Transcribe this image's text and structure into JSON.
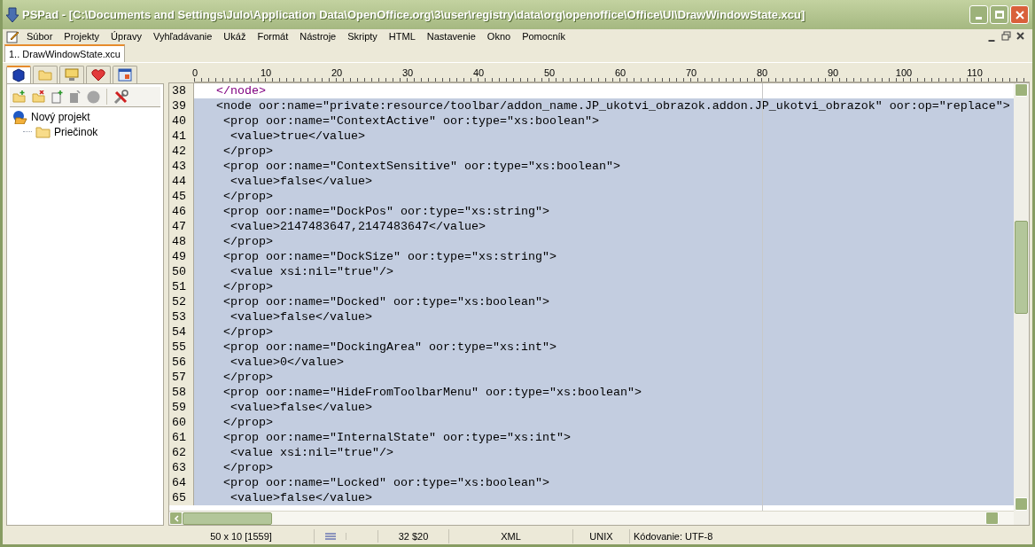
{
  "window": {
    "title": "PSPad - [C:\\Documents and Settings\\Julo\\Application Data\\OpenOffice.org\\3\\user\\registry\\data\\org\\openoffice\\Office\\UI\\DrawWindowState.xcu]"
  },
  "menu": [
    "Súbor",
    "Projekty",
    "Úpravy",
    "Vyhľadávanie",
    "Ukáž",
    "Formát",
    "Nástroje",
    "Skripty",
    "HTML",
    "Nastavenie",
    "Okno",
    "Pomocník"
  ],
  "document_tabs": [
    {
      "label": "1.. DrawWindowState.xcu",
      "selected": true
    }
  ],
  "sidebar": {
    "tabs": [
      {
        "kind": "project",
        "selected": true
      },
      {
        "kind": "folder",
        "selected": false
      },
      {
        "kind": "ftp",
        "selected": false
      },
      {
        "kind": "favorites",
        "selected": false
      },
      {
        "kind": "windows",
        "selected": false
      }
    ],
    "tree": [
      {
        "label": "Nový projekt",
        "kind": "project",
        "children": [
          {
            "label": "Priečinok",
            "kind": "folder"
          }
        ]
      }
    ]
  },
  "ruler": [
    "0",
    "10",
    "20",
    "30",
    "40",
    "50",
    "60",
    "70",
    "80",
    "90",
    "100",
    "110"
  ],
  "editor": {
    "lines": [
      {
        "number": "38",
        "text": "   </node>",
        "selected": false
      },
      {
        "number": "39",
        "text": "   <node oor:name=\"private:resource/toolbar/addon_name.JP_ukotvi_obrazok.addon.JP_ukotvi_obrazok\" oor:op=\"replace\">",
        "selected": true
      },
      {
        "number": "40",
        "text": "    <prop oor:name=\"ContextActive\" oor:type=\"xs:boolean\">",
        "selected": true
      },
      {
        "number": "41",
        "text": "     <value>true</value>",
        "selected": true
      },
      {
        "number": "42",
        "text": "    </prop>",
        "selected": true
      },
      {
        "number": "43",
        "text": "    <prop oor:name=\"ContextSensitive\" oor:type=\"xs:boolean\">",
        "selected": true
      },
      {
        "number": "44",
        "text": "     <value>false</value>",
        "selected": true
      },
      {
        "number": "45",
        "text": "    </prop>",
        "selected": true
      },
      {
        "number": "46",
        "text": "    <prop oor:name=\"DockPos\" oor:type=\"xs:string\">",
        "selected": true
      },
      {
        "number": "47",
        "text": "     <value>2147483647,2147483647</value>",
        "selected": true
      },
      {
        "number": "48",
        "text": "    </prop>",
        "selected": true
      },
      {
        "number": "49",
        "text": "    <prop oor:name=\"DockSize\" oor:type=\"xs:string\">",
        "selected": true
      },
      {
        "number": "50",
        "text": "     <value xsi:nil=\"true\"/>",
        "selected": true
      },
      {
        "number": "51",
        "text": "    </prop>",
        "selected": true
      },
      {
        "number": "52",
        "text": "    <prop oor:name=\"Docked\" oor:type=\"xs:boolean\">",
        "selected": true
      },
      {
        "number": "53",
        "text": "     <value>false</value>",
        "selected": true
      },
      {
        "number": "54",
        "text": "    </prop>",
        "selected": true
      },
      {
        "number": "55",
        "text": "    <prop oor:name=\"DockingArea\" oor:type=\"xs:int\">",
        "selected": true
      },
      {
        "number": "56",
        "text": "     <value>0</value>",
        "selected": true
      },
      {
        "number": "57",
        "text": "    </prop>",
        "selected": true
      },
      {
        "number": "58",
        "text": "    <prop oor:name=\"HideFromToolbarMenu\" oor:type=\"xs:boolean\">",
        "selected": true
      },
      {
        "number": "59",
        "text": "     <value>false</value>",
        "selected": true
      },
      {
        "number": "60",
        "text": "    </prop>",
        "selected": true
      },
      {
        "number": "61",
        "text": "    <prop oor:name=\"InternalState\" oor:type=\"xs:int\">",
        "selected": true
      },
      {
        "number": "62",
        "text": "     <value xsi:nil=\"true\"/>",
        "selected": true
      },
      {
        "number": "63",
        "text": "    </prop>",
        "selected": true
      },
      {
        "number": "64",
        "text": "    <prop oor:name=\"Locked\" oor:type=\"xs:boolean\">",
        "selected": true
      },
      {
        "number": "65",
        "text": "     <value>false</value>",
        "selected": true
      }
    ]
  },
  "status_bar": [
    "50 x 10  [1559]",
    "32  $20",
    "XML",
    "UNIX",
    "Kódovanie: UTF-8"
  ]
}
